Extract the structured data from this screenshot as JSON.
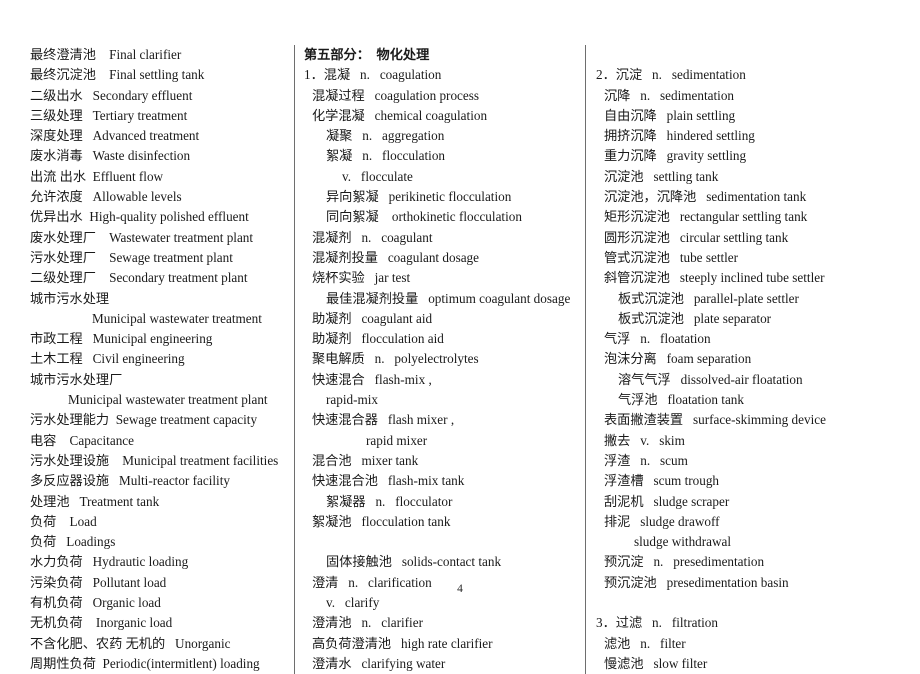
{
  "document": {
    "page_number": "4",
    "columns": [
      {
        "id": "column-1",
        "entries": [
          {
            "text": "最终澄清池    Final clarifier",
            "indent": 0,
            "bold": false
          },
          {
            "text": "最终沉淀池    Final settling tank",
            "indent": 0,
            "bold": false
          },
          {
            "text": "二级出水   Secondary effluent",
            "indent": 0,
            "bold": false
          },
          {
            "text": "三级处理   Tertiary treatment",
            "indent": 0,
            "bold": false
          },
          {
            "text": "深度处理   Advanced treatment",
            "indent": 0,
            "bold": false
          },
          {
            "text": "废水消毒   Waste disinfection",
            "indent": 0,
            "bold": false
          },
          {
            "text": "出流 出水  Effluent flow",
            "indent": 0,
            "bold": false
          },
          {
            "text": "允许浓度   Allowable levels",
            "indent": 0,
            "bold": false
          },
          {
            "text": "优异出水  High-quality polished effluent",
            "indent": 0,
            "bold": false
          },
          {
            "text": "废水处理厂    Wastewater treatment plant",
            "indent": 0,
            "bold": false
          },
          {
            "text": "污水处理厂    Sewage treatment plant",
            "indent": 0,
            "bold": false
          },
          {
            "text": "二级处理厂    Secondary treatment plant",
            "indent": 0,
            "bold": false
          },
          {
            "text": "城市污水处理",
            "indent": 0,
            "bold": false
          },
          {
            "text": "Municipal wastewater treatment",
            "indent": 4,
            "bold": false
          },
          {
            "text": "市政工程   Municipal engineering",
            "indent": 0,
            "bold": false
          },
          {
            "text": "土木工程   Civil engineering",
            "indent": 0,
            "bold": false
          },
          {
            "text": "城市污水处理厂",
            "indent": 0,
            "bold": false
          },
          {
            "text": "Municipal wastewater treatment plant",
            "indent": 3,
            "bold": false
          },
          {
            "text": "污水处理能力  Sewage treatment capacity",
            "indent": 0,
            "bold": false
          },
          {
            "text": "电容    Capacitance",
            "indent": 0,
            "bold": false
          },
          {
            "text": "污水处理设施    Municipal treatment facilities",
            "indent": 0,
            "bold": false
          },
          {
            "text": "多反应器设施   Multi-reactor facility",
            "indent": 0,
            "bold": false
          },
          {
            "text": "处理池   Treatment tank",
            "indent": 0,
            "bold": false
          },
          {
            "text": "负荷    Load",
            "indent": 0,
            "bold": false
          },
          {
            "text": "负荷   Loadings",
            "indent": 0,
            "bold": false
          },
          {
            "text": "水力负荷   Hydrautic loading",
            "indent": 0,
            "bold": false
          },
          {
            "text": "污染负荷   Pollutant load",
            "indent": 0,
            "bold": false
          },
          {
            "text": "有机负荷   Organic load",
            "indent": 0,
            "bold": false
          },
          {
            "text": "无机负荷    Inorganic load",
            "indent": 0,
            "bold": false
          },
          {
            "text": "不含化肥、农药 无机的   Unorganic",
            "indent": 0,
            "bold": false
          },
          {
            "text": "周期性负荷  Periodic(intermitlent) loading",
            "indent": 0,
            "bold": false
          }
        ]
      },
      {
        "id": "column-2",
        "entries": [
          {
            "text": "第五部分：  物化处理",
            "indent": 0,
            "bold": true
          },
          {
            "text": "1．混凝   n.   coagulation",
            "indent": 0,
            "bold": false
          },
          {
            "text": "混凝过程   coagulation process",
            "indent": 1,
            "bold": false
          },
          {
            "text": "化学混凝   chemical coagulation",
            "indent": 1,
            "bold": false
          },
          {
            "text": "凝聚   n.   aggregation",
            "indent": 2,
            "bold": false
          },
          {
            "text": "絮凝   n.   flocculation",
            "indent": 2,
            "bold": false
          },
          {
            "text": "v.   flocculate",
            "indent": 3,
            "bold": false
          },
          {
            "text": "异向絮凝   perikinetic flocculation",
            "indent": 2,
            "bold": false
          },
          {
            "text": "同向絮凝    orthokinetic flocculation",
            "indent": 2,
            "bold": false
          },
          {
            "text": "混凝剂   n.   coagulant",
            "indent": 1,
            "bold": false
          },
          {
            "text": "混凝剂投量   coagulant dosage",
            "indent": 1,
            "bold": false
          },
          {
            "text": "烧杯实验   jar test",
            "indent": 1,
            "bold": false
          },
          {
            "text": "最佳混凝剂投量   optimum coagulant dosage",
            "indent": 2,
            "bold": false
          },
          {
            "text": "助凝剂   coagulant aid",
            "indent": 1,
            "bold": false
          },
          {
            "text": "助凝剂   flocculation aid",
            "indent": 1,
            "bold": false
          },
          {
            "text": "聚电解质   n.   polyelectrolytes",
            "indent": 1,
            "bold": false
          },
          {
            "text": "快速混合   flash-mix ,",
            "indent": 1,
            "bold": false
          },
          {
            "text": "rapid-mix",
            "indent": 2,
            "bold": false
          },
          {
            "text": "快速混合器   flash mixer ,",
            "indent": 1,
            "bold": false
          },
          {
            "text": "rapid mixer",
            "indent": 4,
            "bold": false
          },
          {
            "text": "混合池   mixer tank",
            "indent": 1,
            "bold": false
          },
          {
            "text": "快速混合池   flash-mix tank",
            "indent": 1,
            "bold": false
          },
          {
            "text": "絮凝器   n.   flocculator",
            "indent": 2,
            "bold": false
          },
          {
            "text": "絮凝池   flocculation tank",
            "indent": 1,
            "bold": false
          },
          {
            "text": "",
            "indent": 0,
            "bold": false
          },
          {
            "text": "固体接触池   solids-contact tank",
            "indent": 2,
            "bold": false
          },
          {
            "text": "澄清   n.   clarification",
            "indent": 1,
            "bold": false
          },
          {
            "text": "v.   clarify",
            "indent": 2,
            "bold": false
          },
          {
            "text": "澄清池   n.   clarifier",
            "indent": 1,
            "bold": false
          },
          {
            "text": "高负荷澄清池   high rate clarifier",
            "indent": 1,
            "bold": false
          },
          {
            "text": "澄清水   clarifying water",
            "indent": 1,
            "bold": false
          }
        ]
      },
      {
        "id": "column-3",
        "entries": [
          {
            "text": "",
            "indent": 0,
            "bold": false
          },
          {
            "text": "2．沉淀   n.   sedimentation",
            "indent": 0,
            "bold": false
          },
          {
            "text": "沉降   n.   sedimentation",
            "indent": 1,
            "bold": false
          },
          {
            "text": "自由沉降   plain settling",
            "indent": 1,
            "bold": false
          },
          {
            "text": "拥挤沉降   hindered settling",
            "indent": 1,
            "bold": false
          },
          {
            "text": "重力沉降   gravity settling",
            "indent": 1,
            "bold": false
          },
          {
            "text": "沉淀池   settling tank",
            "indent": 1,
            "bold": false
          },
          {
            "text": "沉淀池，沉降池   sedimentation tank",
            "indent": 1,
            "bold": false
          },
          {
            "text": "矩形沉淀池   rectangular settling tank",
            "indent": 1,
            "bold": false
          },
          {
            "text": "圆形沉淀池   circular settling tank",
            "indent": 1,
            "bold": false
          },
          {
            "text": "管式沉淀池   tube settler",
            "indent": 1,
            "bold": false
          },
          {
            "text": "斜管沉淀池   steeply inclined tube settler",
            "indent": 1,
            "bold": false
          },
          {
            "text": "板式沉淀池   parallel-plate settler",
            "indent": 2,
            "bold": false
          },
          {
            "text": "板式沉淀池   plate separator",
            "indent": 2,
            "bold": false
          },
          {
            "text": "气浮   n.   floatation",
            "indent": 1,
            "bold": false
          },
          {
            "text": "泡沫分离   foam separation",
            "indent": 1,
            "bold": false
          },
          {
            "text": "溶气气浮   dissolved-air floatation",
            "indent": 2,
            "bold": false
          },
          {
            "text": "气浮池   floatation tank",
            "indent": 2,
            "bold": false
          },
          {
            "text": "表面撇渣装置   surface-skimming device",
            "indent": 1,
            "bold": false
          },
          {
            "text": "撇去   v.   skim",
            "indent": 1,
            "bold": false
          },
          {
            "text": "浮渣   n.   scum",
            "indent": 1,
            "bold": false
          },
          {
            "text": "浮渣槽   scum trough",
            "indent": 1,
            "bold": false
          },
          {
            "text": "刮泥机   sludge scraper",
            "indent": 1,
            "bold": false
          },
          {
            "text": "排泥   sludge drawoff",
            "indent": 1,
            "bold": false
          },
          {
            "text": "sludge withdrawal",
            "indent": 3,
            "bold": false
          },
          {
            "text": "预沉淀   n.   presedimentation",
            "indent": 1,
            "bold": false
          },
          {
            "text": "预沉淀池   presedimentation basin",
            "indent": 1,
            "bold": false
          },
          {
            "text": "",
            "indent": 0,
            "bold": false
          },
          {
            "text": "3．过滤   n.   filtration",
            "indent": 0,
            "bold": false
          },
          {
            "text": "滤池   n.   filter",
            "indent": 1,
            "bold": false
          },
          {
            "text": "慢滤池   slow filter",
            "indent": 1,
            "bold": false
          }
        ]
      }
    ]
  }
}
